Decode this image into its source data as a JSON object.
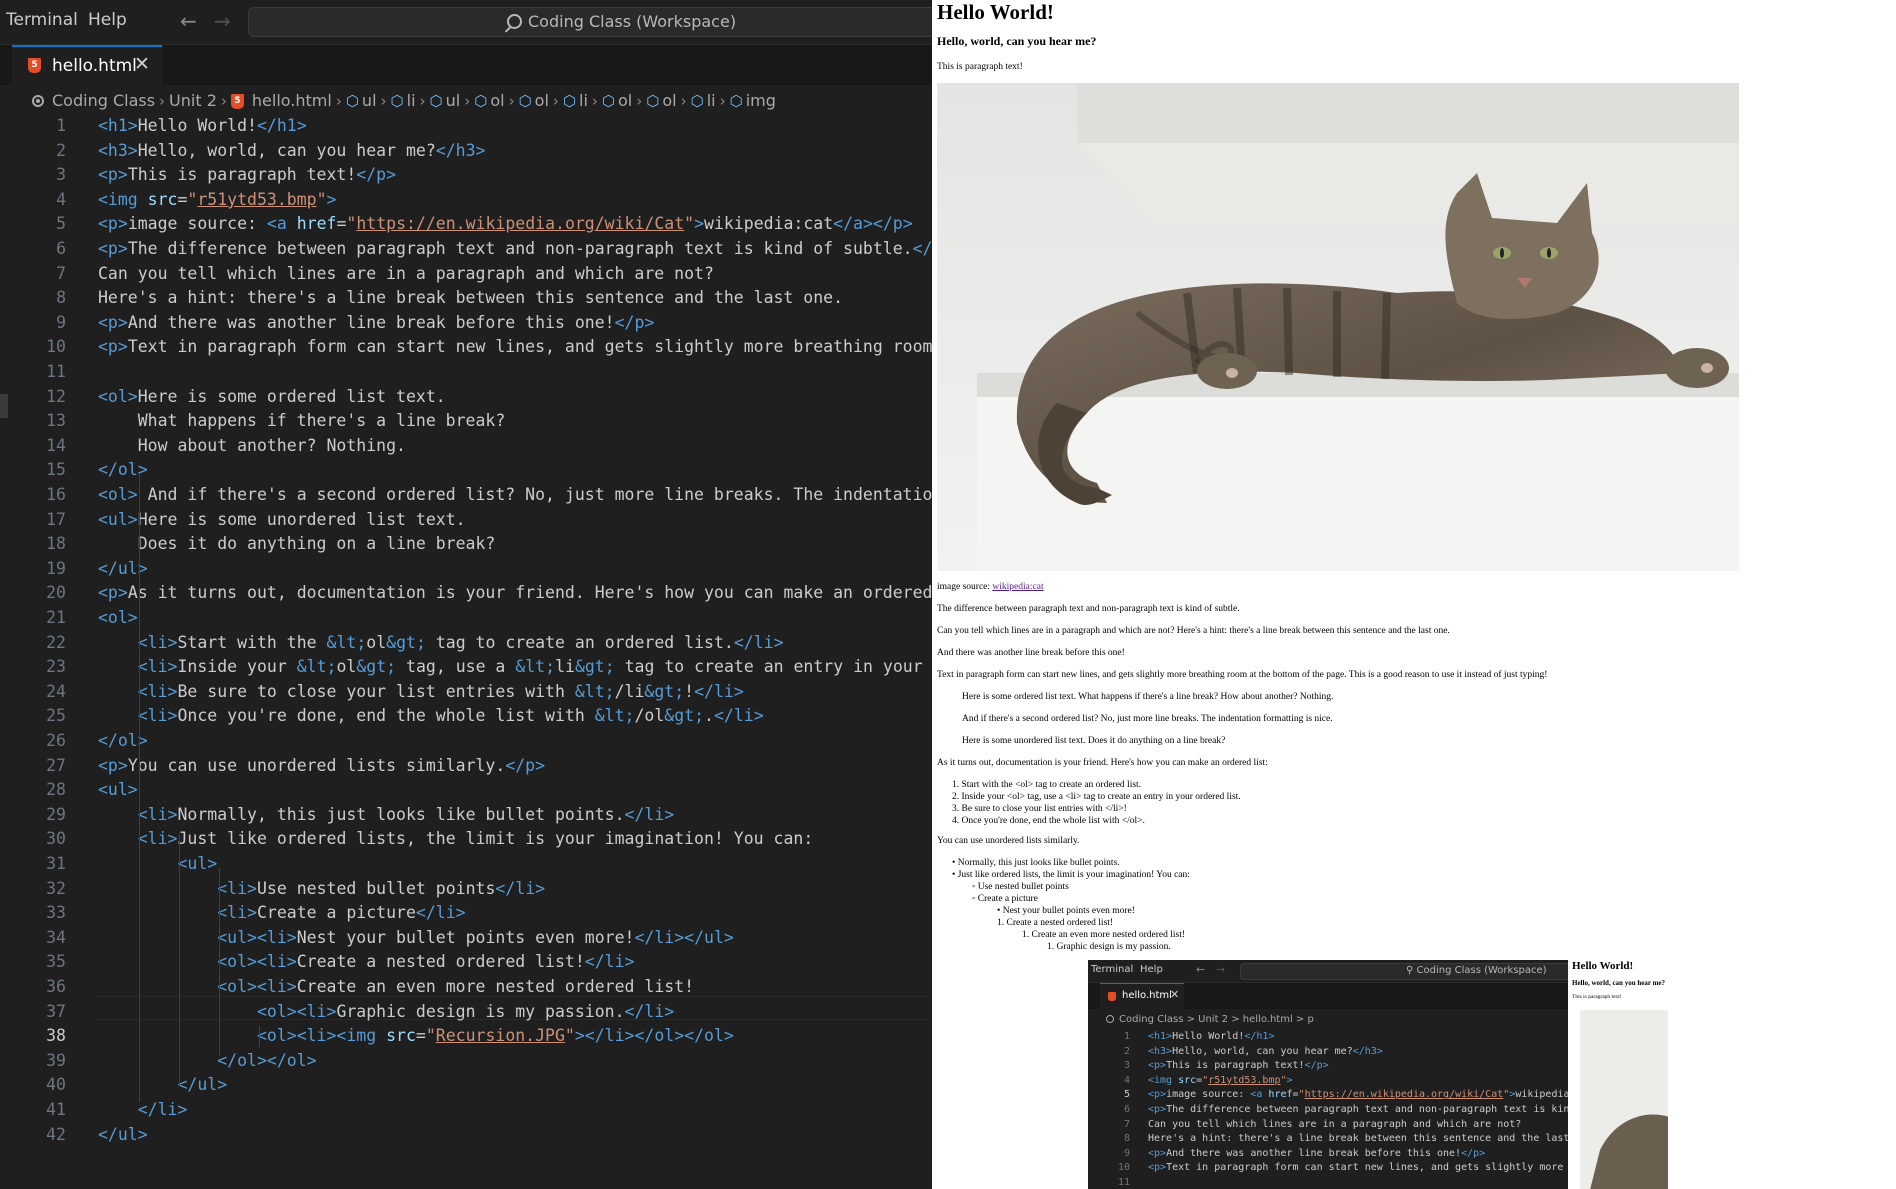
{
  "vscode": {
    "menu": [
      "Terminal",
      "Help"
    ],
    "command_center": "Coding Class (Workspace)",
    "tab": {
      "filename": "hello.html",
      "close": "✕"
    },
    "breadcrumbs": [
      "Coding Class",
      "Unit 2",
      "hello.html",
      "ul",
      "li",
      "ul",
      "ol",
      "ol",
      "li",
      "ol",
      "ol",
      "li",
      "img"
    ],
    "active_line": 38
  },
  "browser": {
    "h1": "Hello World!",
    "h3": "Hello, world, can you hear me?",
    "p1": "This is paragraph text!",
    "image_source_label": "image source: ",
    "image_source_link": "wikipedia:cat",
    "p_subtle": "The difference between paragraph text and non-paragraph text is kind of subtle.",
    "p_hint": "Can you tell which lines are in a paragraph and which are not? Here's a hint: there's a line break between this sentence and the last one.",
    "p_another": "And there was another line break before this one!",
    "p_breathing": "Text in paragraph form can start new lines, and gets slightly more breathing room at the bottom of the page. This is a good reason to use it instead of just typing!",
    "ol1": "Here is some ordered list text. What happens if there's a line break? How about another? Nothing.",
    "ol2": "And if there's a second ordered list? No, just more line breaks. The indentation formatting is nice.",
    "ul1": "Here is some unordered list text. Does it do anything on a line break?",
    "p_doc": "As it turns out, documentation is your friend. Here's how you can make an ordered list:",
    "doc_list": [
      "Start with the <ol> tag to create an ordered list.",
      "Inside your <ol> tag, use a <li> tag to create an entry in your ordered list.",
      "Be sure to close your list entries with </li>!",
      "Once you're done, end the whole list with </ol>."
    ],
    "p_unordered": "You can use unordered lists similarly.",
    "bullets": [
      "Normally, this just looks like bullet points.",
      "Just like ordered lists, the limit is your imagination! You can:"
    ],
    "sub_bullets": [
      "Use nested bullet points",
      "Create a picture"
    ],
    "nest_more": "Nest your bullet points even more!",
    "nested_ordered": "Create a nested ordered list!",
    "even_more": "Create an even more nested ordered list!",
    "graphic": "Graphic design is my passion."
  },
  "nested_screenshot": {
    "menu": [
      "Terminal",
      "Help"
    ],
    "command_center": "Coding Class (Workspace)",
    "tab": "hello.html",
    "breadcrumbs": "Coding Class > Unit 2 > hello.html > p",
    "h1": "Hello World!",
    "h3": "Hello, world, can you hear me?",
    "p": "This is paragraph text!"
  },
  "colors": {
    "tag": "#569cd6",
    "attr": "#9cdcfe",
    "string": "#ce9178",
    "text": "#cccccc",
    "accent": "#0078d4"
  }
}
